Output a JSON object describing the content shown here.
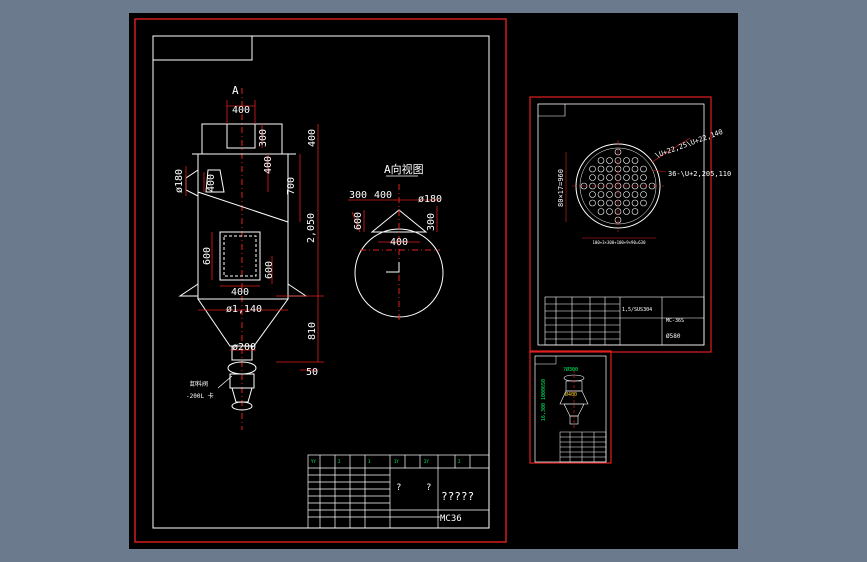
{
  "colors": {
    "background": "#6b7a8c",
    "sheet": "#000000",
    "frame": "#e0201e",
    "line": "#ffffff",
    "dim": "#e0201e",
    "center": "#e0201e",
    "accent": "#00ff66",
    "yellow": "#e8d020"
  },
  "main_view": {
    "view_letter": "A",
    "dims": {
      "top_width": "400",
      "nozzle_h": "300",
      "gap_h": "400",
      "body_seg": "700",
      "total_h": "2,050",
      "inlet_dia": "ø180",
      "inlet_h": "400",
      "window_h": "600",
      "window_w": "400",
      "right_600": "600",
      "body_dia": "ø1,140",
      "cone_h": "810",
      "outlet_dia": "ø200",
      "flange": "50"
    },
    "valve_label_1": "卸料阀",
    "valve_label_2": "-200L 卡"
  },
  "side_view": {
    "title": "A向视图",
    "dims": {
      "d300": "300",
      "d400a": "400",
      "d180": "ø180",
      "d600": "600",
      "d400b": "400",
      "d300b": "300"
    }
  },
  "title_block_main": {
    "q1": "?",
    "q2": "?",
    "title": "?????",
    "code": "MC36"
  },
  "sheet2": {
    "note1": "\\U+22,25\\U+22,140",
    "note2": "36-\\U+2,205,110",
    "vertical": "80×17=960",
    "bottom": "100+3×300+100+9×90=630",
    "material": "1,5/SUS304",
    "code": "MC-36S",
    "dia": "Ø580"
  },
  "sheet3": {
    "top_label": "?Ø300",
    "label2": "Ø400",
    "side": "16,300 1000650"
  }
}
